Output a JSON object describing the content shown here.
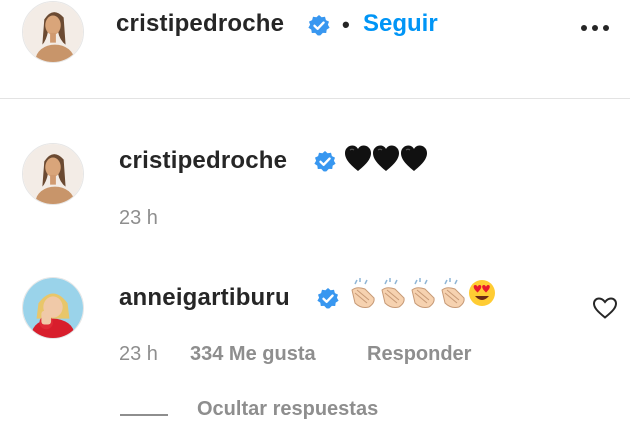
{
  "header": {
    "username": "cristipedroche",
    "separator": "•",
    "follow_label": "Seguir",
    "more_icon": "more-dots-icon",
    "verified_icon": "verified-badge-icon"
  },
  "comments": [
    {
      "username": "cristipedroche",
      "verified": true,
      "text_emojis": [
        "black-heart",
        "black-heart",
        "black-heart"
      ],
      "time": "23 h"
    },
    {
      "username": "anneigartiburu",
      "verified": true,
      "text_emojis": [
        "clapping-hands",
        "clapping-hands",
        "clapping-hands",
        "clapping-hands",
        "heart-eyes-face"
      ],
      "time": "23 h",
      "likes": "334 Me gusta",
      "reply_label": "Responder",
      "like_icon": "heart-outline-icon"
    }
  ],
  "replies_toggle": {
    "label": "Ocultar respuestas"
  },
  "colors": {
    "accent": "#0095f6",
    "verified": "#3897f0",
    "text": "#262626",
    "muted": "#8e8e8e"
  }
}
